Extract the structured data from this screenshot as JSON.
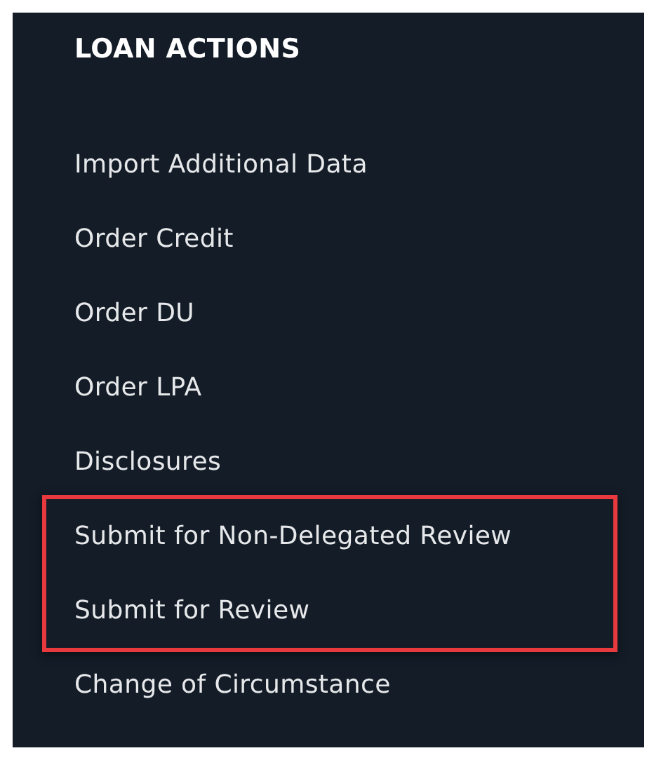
{
  "panel": {
    "title": "LOAN ACTIONS",
    "items": [
      {
        "label": "Import Additional Data",
        "highlighted": false
      },
      {
        "label": "Order Credit",
        "highlighted": false
      },
      {
        "label": "Order DU",
        "highlighted": false
      },
      {
        "label": "Order LPA",
        "highlighted": false
      },
      {
        "label": "Disclosures",
        "highlighted": false
      },
      {
        "label": "Submit for Non-Delegated Review",
        "highlighted": true
      },
      {
        "label": "Submit for Review",
        "highlighted": true
      },
      {
        "label": "Change of Circumstance",
        "highlighted": false
      }
    ]
  }
}
